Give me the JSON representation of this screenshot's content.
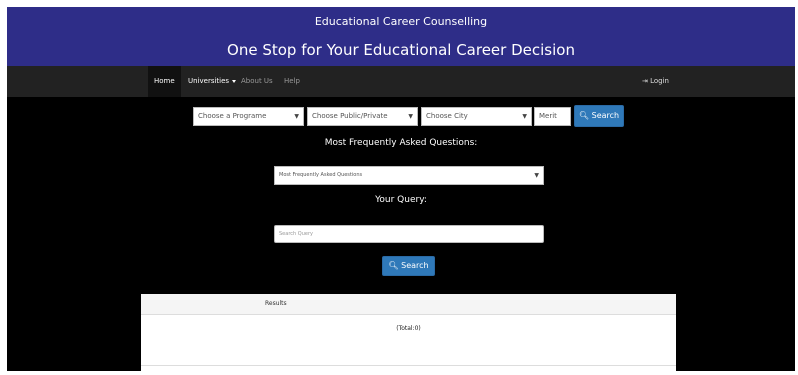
{
  "banner": {
    "title": "Educational Career Counselling",
    "tagline": "One Stop for Your Educational Career Decision"
  },
  "nav": {
    "home": "Home",
    "universities": "Universities",
    "about": "About Us",
    "help": "Help",
    "login": "Login"
  },
  "filters": {
    "programme": "Choose a Programe",
    "sector": "Choose Public/Private",
    "city": "Choose City",
    "merit_placeholder": "Merit",
    "search_label": "Search"
  },
  "faq": {
    "heading": "Most Frequently Asked Questions:",
    "selected": "Most Frequently Asked Questions"
  },
  "query": {
    "heading": "Your Query:",
    "placeholder": "Search Query",
    "search_label": "Search"
  },
  "results": {
    "title": "Results",
    "total": "(Total:0)"
  }
}
